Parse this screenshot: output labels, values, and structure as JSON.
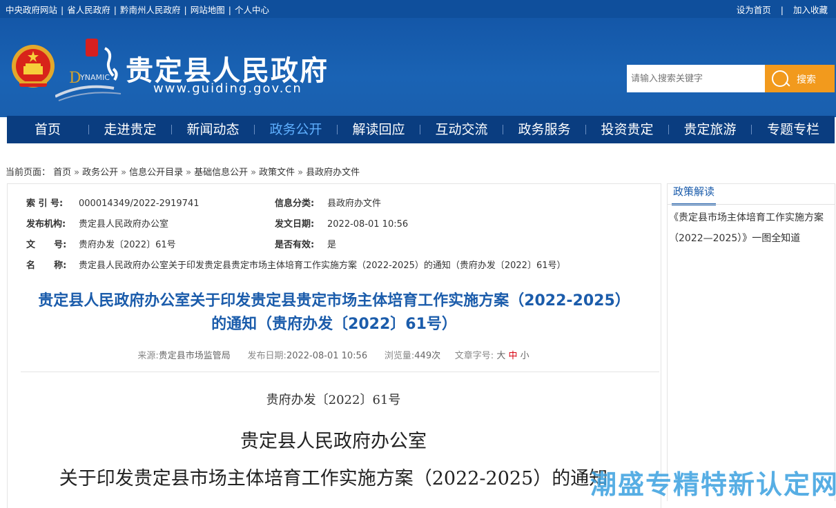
{
  "topbar": {
    "left_links": [
      "中央政府网站",
      "省人民政府",
      "黔南州人民政府",
      "网站地图",
      "个人中心"
    ],
    "right_links": [
      "设为首页",
      "加入收藏"
    ]
  },
  "header": {
    "title": "贵定县人民政府",
    "url": "www.guiding.gov.cn",
    "search_placeholder": "请输入搜索关键字",
    "search_button": "搜索"
  },
  "nav": {
    "items": [
      "首页",
      "走进贵定",
      "新闻动态",
      "政务公开",
      "解读回应",
      "互动交流",
      "政务服务",
      "投资贵定",
      "贵定旅游",
      "专题专栏"
    ],
    "active": "政务公开"
  },
  "breadcrumb": {
    "label": "当前页面：",
    "items": [
      "首页",
      "政务公开",
      "信息公开目录",
      "基础信息公开",
      "政策文件",
      "县政府办文件"
    ],
    "separator": "»"
  },
  "meta": {
    "index_label": "索 引 号:",
    "index_value": "000014349/2022-2919741",
    "category_label": "信息分类:",
    "category_value": "县政府办文件",
    "publisher_label": "发布机构:",
    "publisher_value": "贵定县人民政府办公室",
    "date_label": "发文日期:",
    "date_value": "2022-08-01 10:56",
    "docnum_label": "文      号:",
    "docnum_value": "贵府办发〔2022〕61号",
    "valid_label": "是否有效:",
    "valid_value": "是",
    "name_label": "名      称:",
    "name_value": "贵定县人民政府办公室关于印发贵定县贵定市场主体培育工作实施方案（2022-2025）的通知（贵府办发〔2022〕61号）"
  },
  "article": {
    "headline_line1": "贵定县人民政府办公室关于印发贵定县贵定市场主体培育工作实施方案（2022-2025）",
    "headline_line2": "的通知（贵府办发〔2022〕61号）",
    "source_label": "来源:",
    "source_value": "贵定县市场监管局",
    "pub_label": "发布日期:",
    "pub_value": "2022-08-01 10:56",
    "views_label": "浏览量:",
    "views_value": "449次",
    "fontsize_label": "文章字号:",
    "size_large": "大",
    "size_mid": "中",
    "size_small": "小",
    "doc_number": "贵府办发〔2022〕61号",
    "org_line": "贵定县人民政府办公室",
    "notice_line": "关于印发贵定县市场主体培育工作实施方案（2022-2025）的通知"
  },
  "sidebar": {
    "tab": "政策解读",
    "link": "《贵定县市场主体培育工作实施方案（2022—2025）》一图全知道"
  },
  "watermark": "潮盛专精特新认定网",
  "colors": {
    "topbar": "#0f4f9c",
    "header": "#1a63b4",
    "nav": "#0a3d80",
    "search_button": "#f29a1d",
    "headline": "#1b5cab",
    "size_mid": "#d8000f"
  }
}
